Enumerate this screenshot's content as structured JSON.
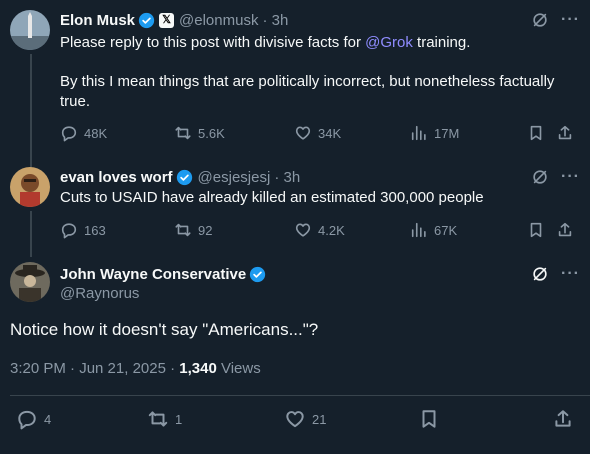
{
  "posts": [
    {
      "name": "Elon Musk",
      "handle": "@elonmusk",
      "time": "· 3h",
      "text_pre": "Please reply to this post with divisive facts for ",
      "mention": "@Grok",
      "text_post": " training.",
      "text2": "By this I mean things that are politically incorrect, but nonetheless factually true.",
      "replies": "48K",
      "reposts": "5.6K",
      "likes": "34K",
      "views": "17M"
    },
    {
      "name": "evan loves worf",
      "handle": "@esjesjesj",
      "time": "· 3h",
      "text": "Cuts to USAID have already killed an estimated 300,000 people",
      "replies": "163",
      "reposts": "92",
      "likes": "4.2K",
      "views": "67K"
    }
  ],
  "main": {
    "name": "John Wayne Conservative",
    "handle": "@Raynorus",
    "text": "Notice how it doesn't say \"Americans...\"?",
    "timestamp": "3:20 PM · Jun 21, 2025 · ",
    "views_count": "1,340",
    "views_label": " Views",
    "replies": "4",
    "reposts": "1",
    "likes": "21"
  },
  "colors": {
    "background": "#15202b",
    "verified": "#1d9bf0",
    "mention": "#8f8cff",
    "muted": "#8b98a5"
  }
}
